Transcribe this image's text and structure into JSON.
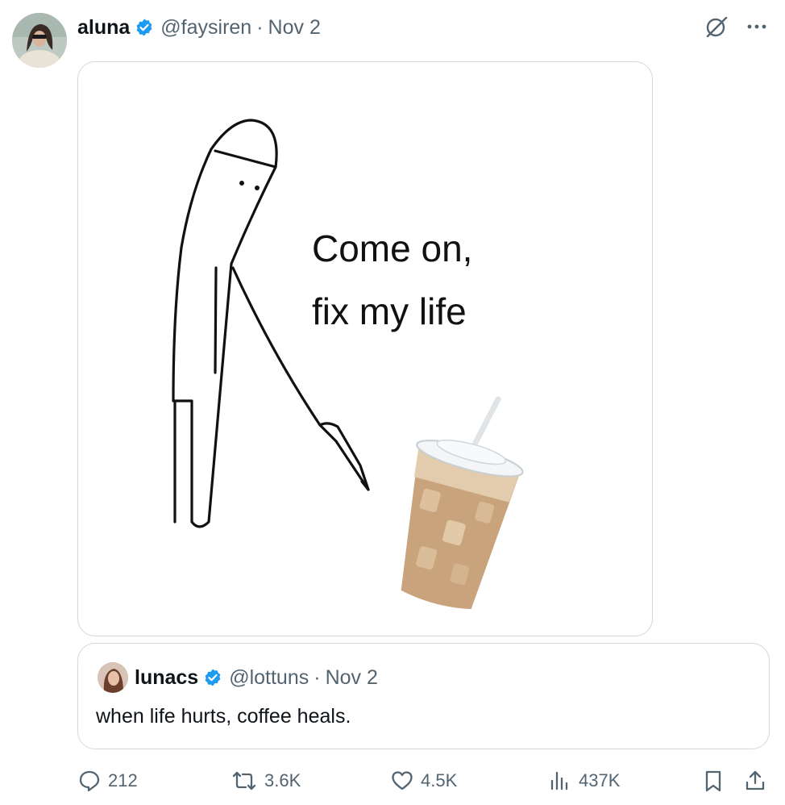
{
  "tweet": {
    "author_name": "aluna",
    "handle": "@faysiren",
    "separator": "·",
    "date": "Nov 2"
  },
  "media": {
    "caption_text": "Come on,\nfix my life"
  },
  "quote": {
    "author_name": "lunacs",
    "handle": "@lottuns",
    "separator": "·",
    "date": "Nov 2",
    "text": "when life hurts, coffee heals."
  },
  "actions": {
    "replies": "212",
    "reposts": "3.6K",
    "likes": "4.5K",
    "views": "437K"
  },
  "colors": {
    "text_primary": "#0f1419",
    "text_secondary": "#536471",
    "verified_blue": "#1d9bf0",
    "border": "#cfd9de"
  }
}
